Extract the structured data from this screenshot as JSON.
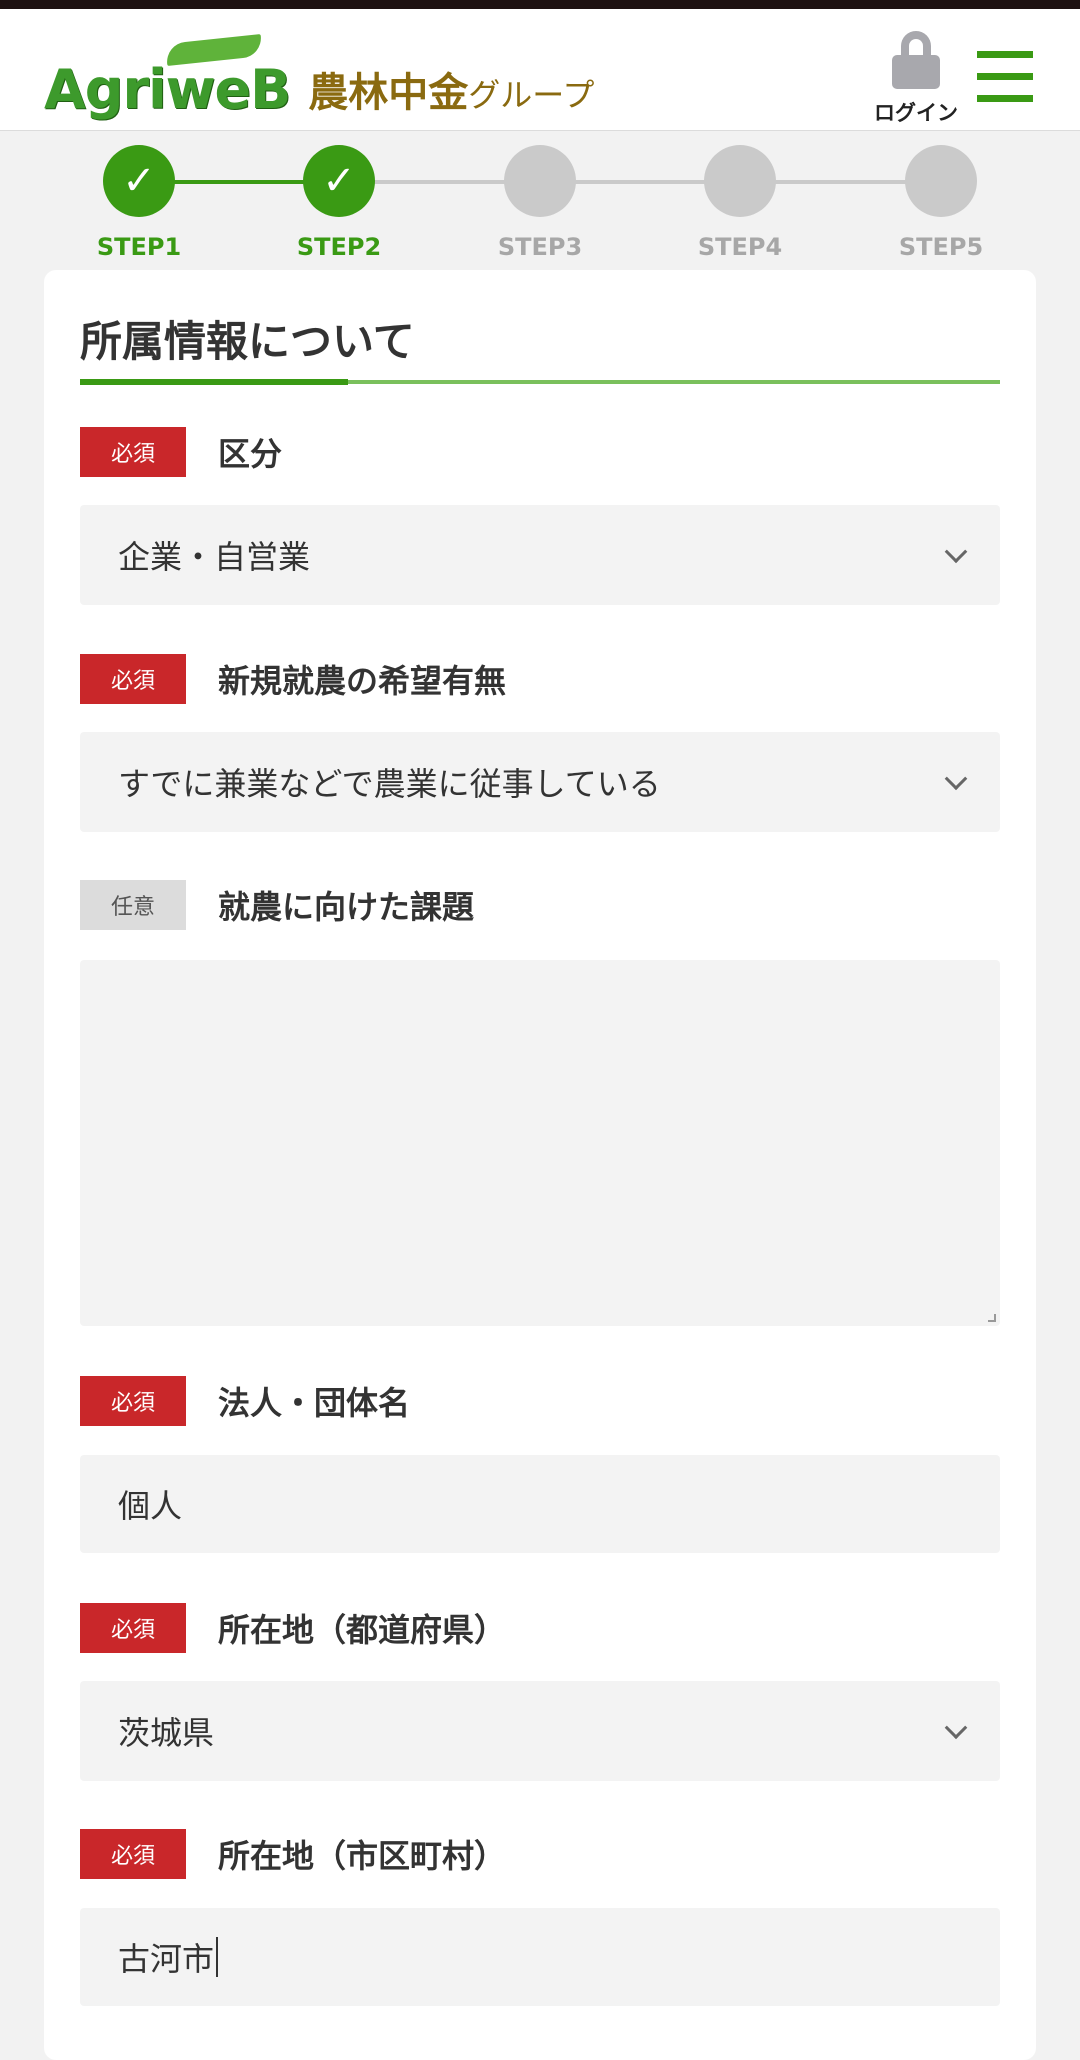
{
  "header": {
    "logo_brand": "AgriweB",
    "logo_group_main": "農林中金",
    "logo_group_suffix": "グループ",
    "login_label": "ログイン",
    "accent_color": "#3a9a14"
  },
  "steps": [
    {
      "label": "STEP1",
      "status": "done"
    },
    {
      "label": "STEP2",
      "status": "done"
    },
    {
      "label": "STEP3",
      "status": "pending"
    },
    {
      "label": "STEP4",
      "status": "pending"
    },
    {
      "label": "STEP5",
      "status": "pending"
    }
  ],
  "form": {
    "section_title": "所属情報について",
    "required_badge": "必須",
    "optional_badge": "任意",
    "fields": {
      "category": {
        "label": "区分",
        "value": "企業・自営業"
      },
      "new_farming": {
        "label": "新規就農の希望有無",
        "value": "すでに兼業などで農業に従事している"
      },
      "issues": {
        "label": "就農に向けた課題",
        "value": ""
      },
      "org_name": {
        "label": "法人・団体名",
        "value": "個人"
      },
      "prefecture": {
        "label": "所在地（都道府県）",
        "value": "茨城県"
      },
      "city": {
        "label": "所在地（市区町村）",
        "value": "古河市"
      }
    }
  }
}
